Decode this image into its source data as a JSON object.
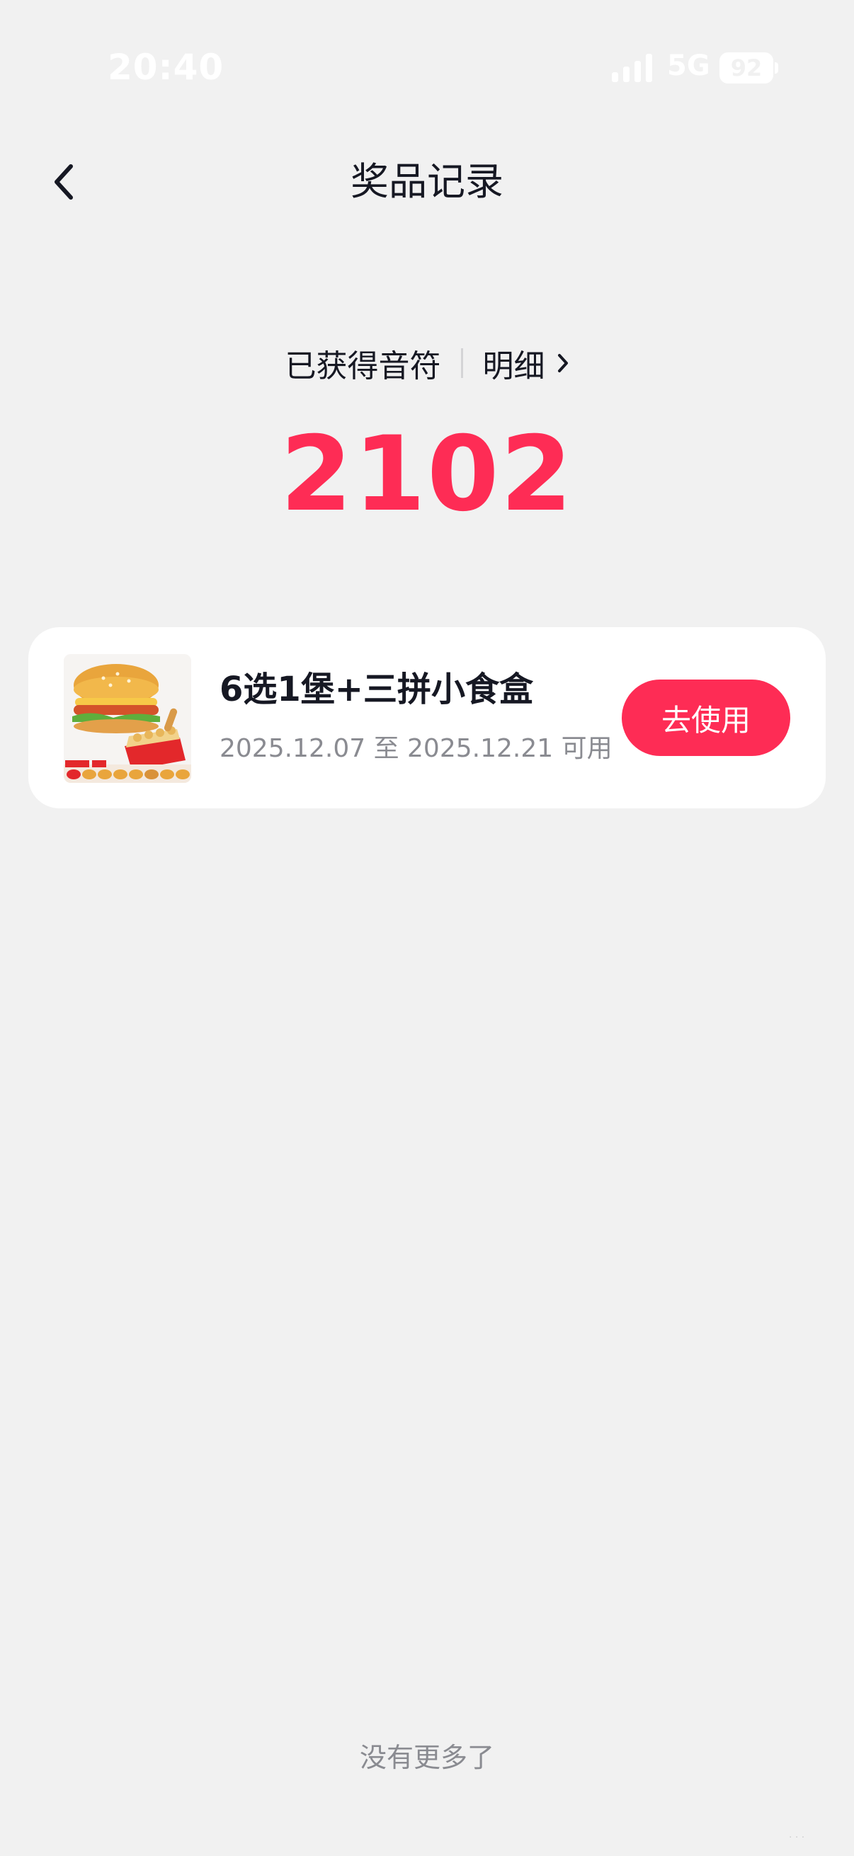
{
  "status_bar": {
    "time": "20:40",
    "network": "5G",
    "battery": "92"
  },
  "nav": {
    "title": "奖品记录",
    "back_icon": "chevron-left-icon"
  },
  "summary": {
    "label": "已获得音符",
    "detail_link": "明细",
    "points": "2102"
  },
  "prizes": [
    {
      "name": "6选1堡+三拼小食盒",
      "validity": "2025.12.07 至 2025.12.21 可用",
      "button_label": "去使用",
      "image_icon": "burger-meal-image"
    }
  ],
  "footer": {
    "no_more": "没有更多了"
  },
  "colors": {
    "accent": "#fe2c55",
    "background": "#f1f1f1",
    "card": "#ffffff"
  }
}
